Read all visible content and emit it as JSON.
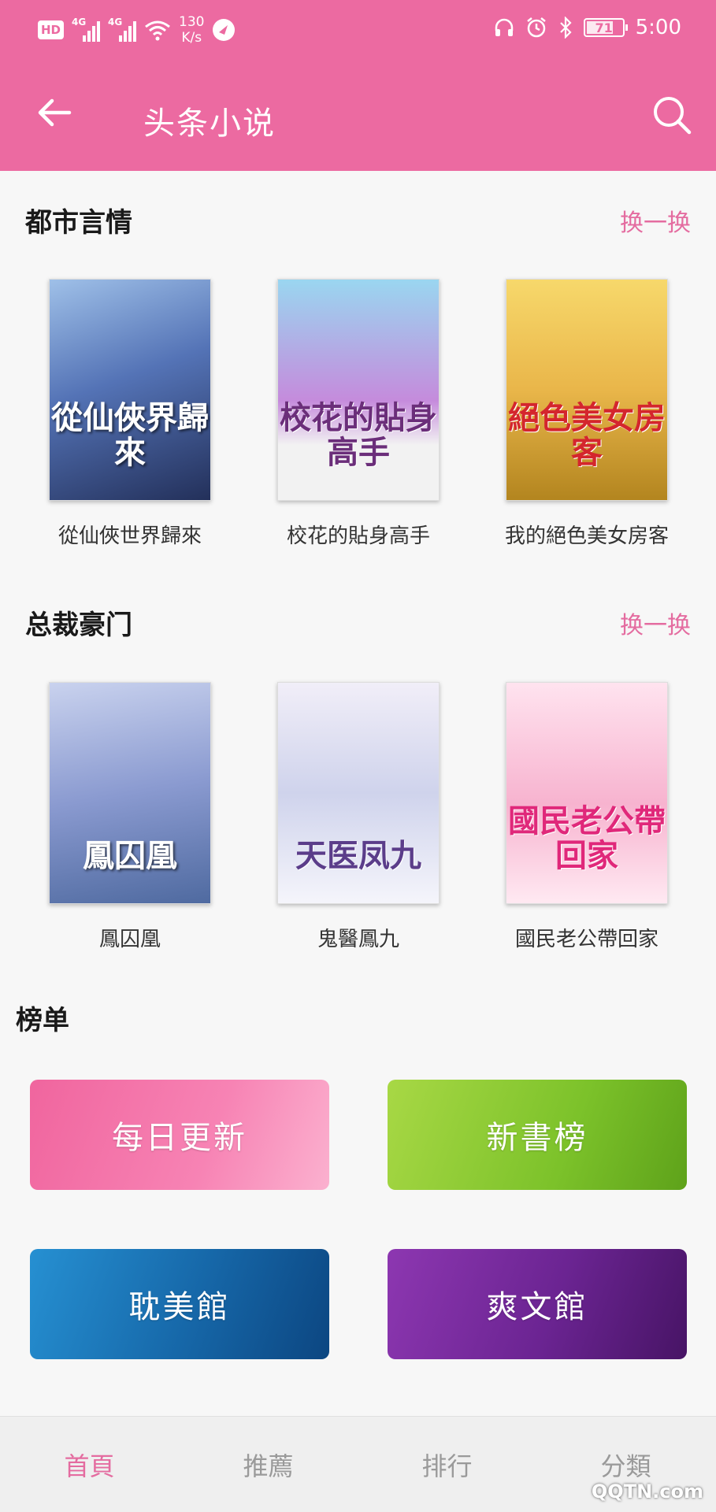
{
  "status_bar": {
    "hd": "HD",
    "net1": "4G",
    "net2": "4G",
    "speed_value": "130",
    "speed_unit": "K/s",
    "battery": "71",
    "time": "5:00"
  },
  "header": {
    "title": "头条小说",
    "back_icon": "arrow-left-icon",
    "search_icon": "search-icon"
  },
  "sections": [
    {
      "title": "都市言情",
      "refresh_label": "换一换",
      "books": [
        {
          "name": "從仙俠世界歸來",
          "cover_text": "從仙俠界歸來",
          "colors": [
            "#6c8fc9",
            "#2e3f6e"
          ]
        },
        {
          "name": "校花的貼身高手",
          "cover_text": "校花的貼身高手",
          "colors": [
            "#8fd0e8",
            "#d27bd0"
          ]
        },
        {
          "name": "我的絕色美女房客",
          "cover_text": "絕色美女房客",
          "colors": [
            "#f2c85a",
            "#b8861f"
          ]
        }
      ]
    },
    {
      "title": "总裁豪门",
      "refresh_label": "换一换",
      "books": [
        {
          "name": "鳳囚凰",
          "cover_text": "鳳囚凰",
          "colors": [
            "#b8c4e6",
            "#5a6fa6"
          ]
        },
        {
          "name": "鬼醫鳳九",
          "cover_text": "天医凤九",
          "colors": [
            "#e9e4f3",
            "#b9c1e0"
          ]
        },
        {
          "name": "國民老公帶回家",
          "cover_text": "國民老公帶回家",
          "colors": [
            "#ffd3e6",
            "#f39cbf"
          ]
        }
      ]
    }
  ],
  "ranking": {
    "title": "榜单",
    "cards": [
      {
        "label": "每日更新",
        "colors": [
          "#f1689f",
          "#fba3c6"
        ]
      },
      {
        "label": "新書榜",
        "colors": [
          "#9ad13c",
          "#6fb11f"
        ]
      },
      {
        "label": "耽美館",
        "colors": [
          "#1f7fc2",
          "#0f4f8a"
        ]
      },
      {
        "label": "爽文館",
        "colors": [
          "#7b2b9e",
          "#4c176b"
        ]
      }
    ]
  },
  "bottom_nav": {
    "tabs": [
      "首頁",
      "推薦",
      "排行",
      "分類"
    ],
    "active": 0
  },
  "watermark": "QQTN.com",
  "theme": {
    "accent": "#ec6aa1"
  }
}
